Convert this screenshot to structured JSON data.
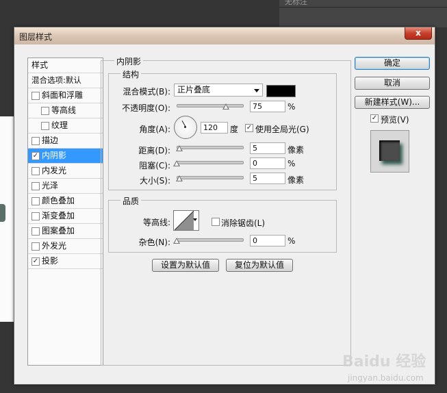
{
  "background": {
    "panel_title": "无标注"
  },
  "dialog": {
    "title": "图层样式",
    "close": "x",
    "styles_header": "样式",
    "blend_default": "混合选项:默认",
    "styles": [
      {
        "label": "斜面和浮雕",
        "checked": false,
        "sub": false
      },
      {
        "label": "等高线",
        "checked": false,
        "sub": true
      },
      {
        "label": "纹理",
        "checked": false,
        "sub": true
      },
      {
        "label": "描边",
        "checked": false,
        "sub": false
      },
      {
        "label": "内阴影",
        "checked": true,
        "sub": false,
        "selected": true
      },
      {
        "label": "内发光",
        "checked": false,
        "sub": false
      },
      {
        "label": "光泽",
        "checked": false,
        "sub": false
      },
      {
        "label": "颜色叠加",
        "checked": false,
        "sub": false
      },
      {
        "label": "渐变叠加",
        "checked": false,
        "sub": false
      },
      {
        "label": "图案叠加",
        "checked": false,
        "sub": false
      },
      {
        "label": "外发光",
        "checked": false,
        "sub": false
      },
      {
        "label": "投影",
        "checked": true,
        "sub": false
      }
    ],
    "panel_title": "内阴影",
    "structure": {
      "title": "结构",
      "blend_mode_label": "混合模式(B):",
      "blend_mode_value": "正片叠底",
      "shadow_color": "#000000",
      "opacity_label": "不透明度(O):",
      "opacity_value": "75",
      "opacity_unit": "%",
      "angle_label": "角度(A):",
      "angle_value": "120",
      "angle_unit": "度",
      "global_light_label": "使用全局光(G)",
      "global_light_checked": true,
      "distance_label": "距离(D):",
      "distance_value": "5",
      "distance_unit": "像素",
      "choke_label": "阻塞(C):",
      "choke_value": "0",
      "choke_unit": "%",
      "size_label": "大小(S):",
      "size_value": "5",
      "size_unit": "像素"
    },
    "quality": {
      "title": "品质",
      "contour_label": "等高线:",
      "antialias_label": "消除锯齿(L)",
      "antialias_checked": false,
      "noise_label": "杂色(N):",
      "noise_value": "0",
      "noise_unit": "%"
    },
    "buttons": {
      "set_default": "设置为默认值",
      "reset_default": "复位为默认值",
      "ok": "确定",
      "cancel": "取消",
      "new_style": "新建样式(W)...",
      "preview_label": "预览(V)",
      "preview_checked": true
    }
  },
  "watermark": {
    "logo": "Baidu 经验",
    "url": "jingyan.baidu.com"
  }
}
